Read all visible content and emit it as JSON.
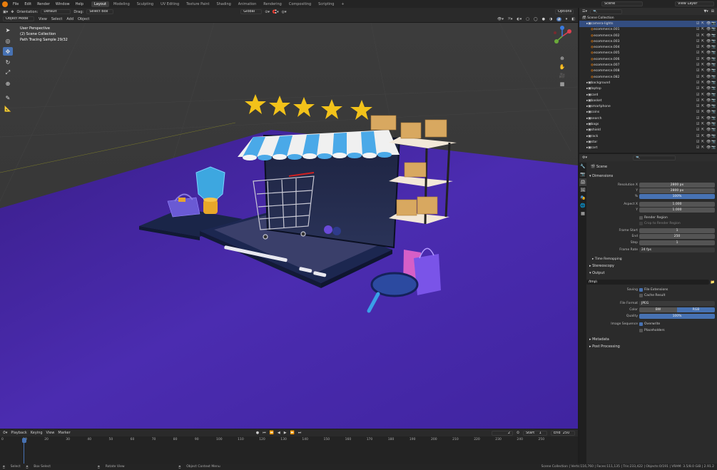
{
  "menubar": {
    "items": [
      "File",
      "Edit",
      "Render",
      "Window",
      "Help"
    ],
    "workspaces": [
      "Layout",
      "Modeling",
      "Sculpting",
      "UV Editing",
      "Texture Paint",
      "Shading",
      "Animation",
      "Rendering",
      "Compositing",
      "Scripting"
    ],
    "scene": "Scene",
    "view_layer": "View Layer"
  },
  "tool_header": {
    "orientation_label": "Orientation:",
    "orientation": "Default",
    "drag_label": "Drag:",
    "drag": "Select Box",
    "transform": "Global",
    "options": "Options"
  },
  "view_header": {
    "mode": "Object Mode",
    "items": [
      "View",
      "Select",
      "Add",
      "Object"
    ]
  },
  "viewport_info": {
    "line1": "User Perspective",
    "line2": "(2) Scene Collection",
    "line3": "Path Tracing Sample 29/32"
  },
  "outliner": {
    "root": "Scene Collection",
    "rows": [
      {
        "name": "camera-lights",
        "indent": 1
      },
      {
        "name": "ecommerce.001",
        "indent": 2
      },
      {
        "name": "ecommerce.002",
        "indent": 2
      },
      {
        "name": "ecommerce.003",
        "indent": 2
      },
      {
        "name": "ecommerce.004",
        "indent": 2
      },
      {
        "name": "ecommerce.005",
        "indent": 2
      },
      {
        "name": "ecommerce.006",
        "indent": 2
      },
      {
        "name": "ecommerce.007",
        "indent": 2
      },
      {
        "name": "ecommerce.008",
        "indent": 2
      },
      {
        "name": "ecommerce.082",
        "indent": 2
      },
      {
        "name": "background",
        "indent": 1
      },
      {
        "name": "laptop",
        "indent": 1
      },
      {
        "name": "card",
        "indent": 1
      },
      {
        "name": "basket",
        "indent": 1
      },
      {
        "name": "smartphone",
        "indent": 1
      },
      {
        "name": "coins",
        "indent": 1
      },
      {
        "name": "search",
        "indent": 1
      },
      {
        "name": "bags",
        "indent": 1
      },
      {
        "name": "shield",
        "indent": 1
      },
      {
        "name": "rack",
        "indent": 1
      },
      {
        "name": "star",
        "indent": 1
      },
      {
        "name": "cart",
        "indent": 1
      }
    ]
  },
  "properties": {
    "context": "Scene",
    "dimensions": {
      "header": "Dimensions",
      "resolution_x_label": "Resolution X",
      "resolution_x": "2800 px",
      "y_label": "Y",
      "resolution_y": "2800 px",
      "pct_label": "%",
      "pct": "100%",
      "aspect_x_label": "Aspect X",
      "aspect_x": "1.000",
      "aspect_y_label": "Y",
      "aspect_y": "1.000",
      "render_region": "Render Region",
      "crop": "Crop to Render Region",
      "frame_start_label": "Frame Start",
      "frame_start": "1",
      "end_label": "End",
      "end": "250",
      "step_label": "Step",
      "step": "1",
      "frame_rate_label": "Frame Rate",
      "frame_rate": "24 fps"
    },
    "time_remapping": "Time Remapping",
    "stereoscopy": "Stereoscopy",
    "output": {
      "header": "Output",
      "path": "/tmp\\",
      "saving_label": "Saving",
      "file_extensions": "File Extensions",
      "cache_result": "Cache Result",
      "file_format_label": "File Format",
      "file_format": "JPEG",
      "color_label": "Color",
      "bw": "BW",
      "rgb": "RGB",
      "quality_label": "Quality",
      "quality": "100%",
      "image_sequence_label": "Image Sequence",
      "overwrite": "Overwrite",
      "placeholders": "Placeholders"
    },
    "metadata": "Metadata",
    "post_processing": "Post Processing"
  },
  "timeline": {
    "items": [
      "Playback",
      "Keying",
      "View",
      "Marker"
    ],
    "current_frame": "2",
    "start_label": "Start",
    "start": "1",
    "end_label": "End",
    "end": "250",
    "ticks": [
      "0",
      "10",
      "20",
      "30",
      "40",
      "50",
      "60",
      "70",
      "80",
      "90",
      "100",
      "110",
      "120",
      "130",
      "140",
      "150",
      "160",
      "170",
      "180",
      "190",
      "200",
      "210",
      "220",
      "230",
      "240",
      "250"
    ]
  },
  "statusbar": {
    "select": "Select",
    "box_select": "Box Select",
    "rotate_view": "Rotate View",
    "context_menu": "Object Context Menu",
    "stats": "Scene Collection | Verts:116,760 | Faces:111,135 | Tris:233,422 | Objects:0/191 | VRAM: 3.5/8.0 GiB | 2.91.2"
  },
  "colors": {
    "accent": "#4772b3",
    "floor": "#4a2aa8",
    "orange": "#e87d0d"
  }
}
